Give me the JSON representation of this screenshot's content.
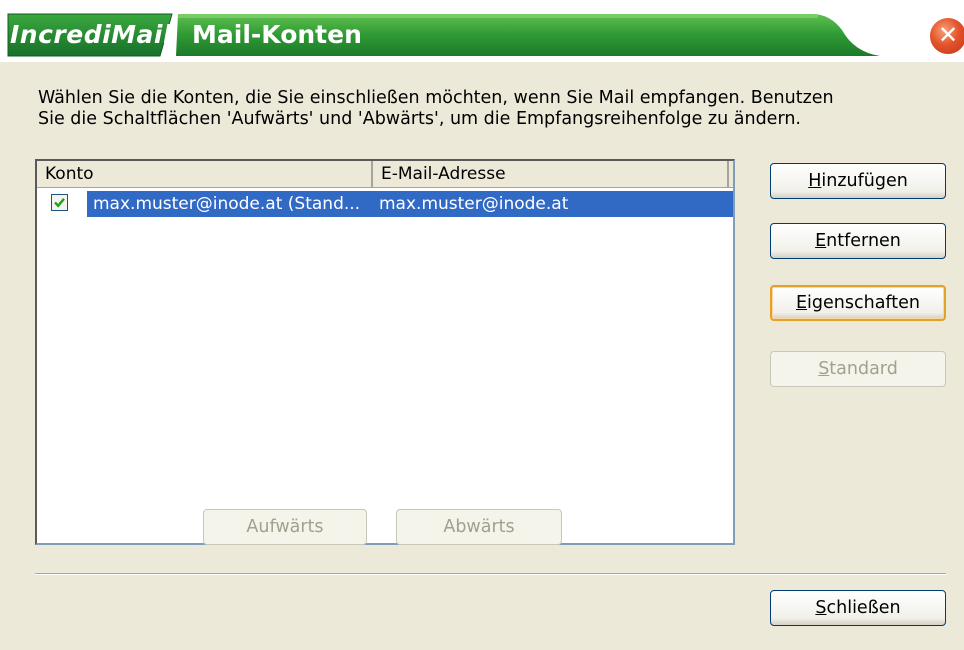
{
  "window": {
    "brand": "IncrediMail",
    "title": "Mail-Konten",
    "close_symbol": "✕",
    "colors": {
      "titlebar_green": "#1f8a2e",
      "selection": "#316ac5",
      "close_red": "#e4532a"
    }
  },
  "description": {
    "line1": "Wählen Sie die Konten, die Sie einschließen möchten, wenn Sie Mail empfangen. Benutzen",
    "line2": "Sie die Schaltflächen 'Aufwärts' und 'Abwärts', um die Empfangsreihenfolge zu ändern."
  },
  "list": {
    "columns": [
      "Konto",
      "E-Mail-Adresse"
    ],
    "rows": [
      {
        "checked": true,
        "account": "max.muster@inode.at (Stand...",
        "email": "max.muster@inode.at"
      }
    ]
  },
  "buttons": {
    "add": {
      "prefix": "",
      "key": "H",
      "rest": "inzufügen"
    },
    "remove": {
      "prefix": "",
      "key": "E",
      "rest": "ntfernen"
    },
    "properties": {
      "prefix": "",
      "key": "E",
      "rest": "igenschaften"
    },
    "default": {
      "prefix": "",
      "key": "S",
      "rest": "tandard"
    },
    "up": "Aufwärts",
    "down": "Abwärts",
    "close": {
      "prefix": "",
      "key": "S",
      "rest": "chließen"
    }
  },
  "icons": {
    "close": "close-icon",
    "checkmark": "checkmark-icon"
  }
}
